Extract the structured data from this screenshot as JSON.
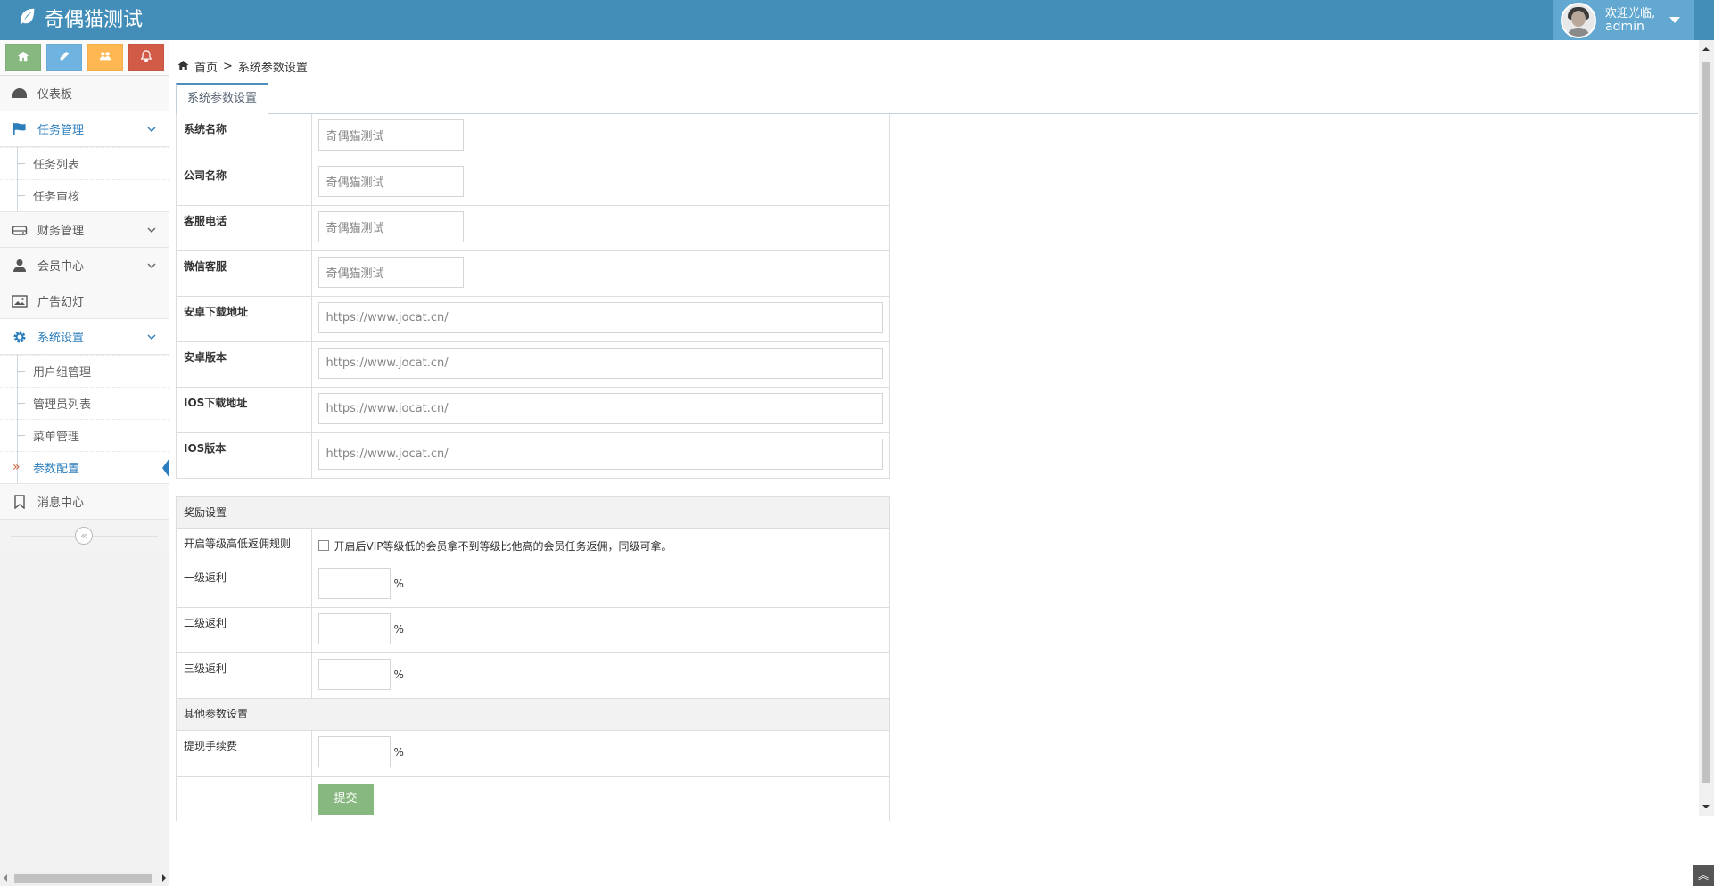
{
  "app": {
    "title": "奇偶猫测试"
  },
  "user": {
    "welcome": "欢迎光临,",
    "name": "admin"
  },
  "sidebar": {
    "items": [
      {
        "label": "仪表板"
      },
      {
        "label": "任务管理",
        "children": [
          "任务列表",
          "任务审核"
        ]
      },
      {
        "label": "财务管理"
      },
      {
        "label": "会员中心"
      },
      {
        "label": "广告幻灯"
      },
      {
        "label": "系统设置",
        "children": [
          "用户组管理",
          "管理员列表",
          "菜单管理",
          "参数配置"
        ]
      },
      {
        "label": "消息中心"
      }
    ],
    "collapse_glyph": "«"
  },
  "breadcrumb": {
    "home": "首页",
    "separator": ">",
    "current": "系统参数设置"
  },
  "tab": {
    "label": "系统参数设置"
  },
  "form": {
    "fields": [
      {
        "label": "系统名称",
        "value": "奇偶猫测试"
      },
      {
        "label": "公司名称",
        "value": "奇偶猫测试"
      },
      {
        "label": "客服电话",
        "value": "奇偶猫测试"
      },
      {
        "label": "微信客服",
        "value": "奇偶猫测试"
      },
      {
        "label": "安卓下载地址",
        "value": "https://www.jocat.cn/"
      },
      {
        "label": "安卓版本",
        "value": "https://www.jocat.cn/"
      },
      {
        "label": "IOS下载地址",
        "value": "https://www.jocat.cn/"
      },
      {
        "label": "IOS版本",
        "value": "https://www.jocat.cn/"
      }
    ],
    "reward_section": {
      "title": "奖励设置",
      "rule_label": "开启等级高低返佣规则",
      "rule_text": "开启后VIP等级低的会员拿不到等级比他高的会员任务返佣，同级可拿。",
      "levels": [
        {
          "label": "一级返利",
          "value": "",
          "unit": "%"
        },
        {
          "label": "二级返利",
          "value": "",
          "unit": "%"
        },
        {
          "label": "三级返利",
          "value": "",
          "unit": "%"
        }
      ]
    },
    "other_section": {
      "title": "其他参数设置",
      "fee_label": "提现手续费",
      "fee_value": "",
      "fee_unit": "%"
    },
    "submit_label": "提交"
  },
  "colors": {
    "navbar": "#438eb9",
    "accent": "#2b7dbc",
    "submit": "#87b87f"
  }
}
